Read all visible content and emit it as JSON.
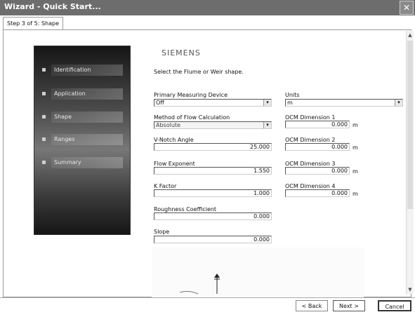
{
  "window": {
    "title": "Wizard - Quick Start..."
  },
  "tab": {
    "label": "Step 3 of 5: Shape"
  },
  "nav": {
    "items": [
      "Identification",
      "Application",
      "Shape",
      "Ranges",
      "Summary"
    ]
  },
  "content": {
    "logo": "SIEMENS",
    "prompt": "Select the Flume or Weir shape.",
    "primary_device": {
      "label": "Primary Measuring Device",
      "value": "Off"
    },
    "method": {
      "label": "Method of Flow Calculation",
      "value": "Absolute"
    },
    "vnotch": {
      "label": "V-Notch Angle",
      "value": "25.000"
    },
    "flow_exponent": {
      "label": "Flow Exponent",
      "value": "1.550"
    },
    "k_factor": {
      "label": "K Factor",
      "value": "1.000"
    },
    "roughness": {
      "label": "Roughness Coefficient",
      "value": "0.000"
    },
    "slope": {
      "label": "Slope",
      "value": "0.000"
    },
    "units": {
      "label": "Units",
      "value": "m"
    },
    "ocm1": {
      "label": "OCM Dimension 1",
      "value": "0.000",
      "unit": "m"
    },
    "ocm2": {
      "label": "OCM Dimension 2",
      "value": "0.000",
      "unit": "m"
    },
    "ocm3": {
      "label": "OCM Dimension 3",
      "value": "0.000",
      "unit": "m"
    },
    "ocm4": {
      "label": "OCM Dimension 4",
      "value": "0.000",
      "unit": "m"
    }
  },
  "buttons": {
    "back": "< Back",
    "next": "Next >",
    "cancel": "Cancel"
  },
  "icons": {
    "close": "close-icon",
    "dropdown": "chevron-down-icon",
    "scroll_up": "scroll-up-icon",
    "scroll_down": "scroll-down-icon"
  }
}
